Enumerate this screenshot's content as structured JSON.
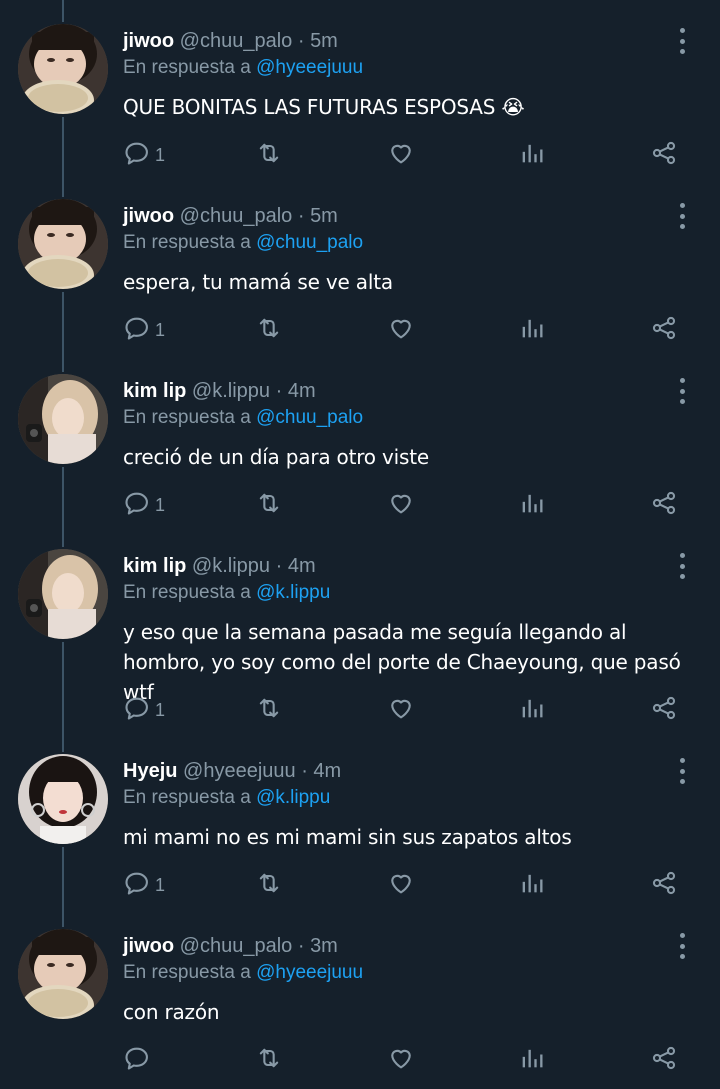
{
  "reply_prefix": "En respuesta a",
  "colors": {
    "background": "#15202b",
    "accent": "#1da1f2",
    "muted": "#8899a6"
  },
  "icons": [
    "reply-icon",
    "retweet-icon",
    "like-icon",
    "analytics-icon",
    "share-icon",
    "more-options-icon"
  ],
  "tweets": [
    {
      "name": "jiwoo",
      "handle": "@chuu_palo",
      "time": "5m",
      "reply_to": "@hyeeejuuu",
      "text": "QUE BONITAS LAS FUTURAS ESPOSAS 😭",
      "reply_count": "1"
    },
    {
      "name": "jiwoo",
      "handle": "@chuu_palo",
      "time": "5m",
      "reply_to": "@chuu_palo",
      "text": "espera, tu mamá se ve alta",
      "reply_count": "1"
    },
    {
      "name": "kim lip",
      "handle": "@k.lippu",
      "time": "4m",
      "reply_to": "@chuu_palo",
      "text": "creció de un día para otro viste",
      "reply_count": "1"
    },
    {
      "name": "kim lip",
      "handle": "@k.lippu",
      "time": "4m",
      "reply_to": "@k.lippu",
      "text": "y eso que la semana pasada me seguía llegando al hombro, yo soy como del porte de Chaeyoung, que pasó wtf",
      "reply_count": "1"
    },
    {
      "name": "Hyeju",
      "handle": "@hyeeejuuu",
      "time": "4m",
      "reply_to": "@k.lippu",
      "text": "mi mami no es mi mami sin sus zapatos altos",
      "reply_count": "1"
    },
    {
      "name": "jiwoo",
      "handle": "@chuu_palo",
      "time": "3m",
      "reply_to": "@hyeeejuuu",
      "text": "con razón",
      "reply_count": ""
    }
  ]
}
